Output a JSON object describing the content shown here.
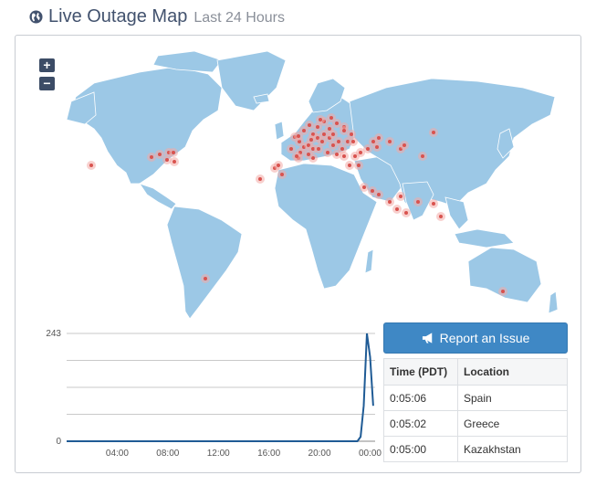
{
  "header": {
    "title": "Live Outage Map",
    "subtitle": "Last 24 Hours"
  },
  "map": {
    "zoom_in": "+",
    "zoom_out": "−",
    "land_color": "#9cc8e6",
    "marker_color": "#d9534f"
  },
  "report_button": {
    "label": "Report an Issue",
    "color": "#3f88c5"
  },
  "table": {
    "headers": [
      "Time (PDT)",
      "Location"
    ],
    "rows": [
      [
        "0:05:06",
        "Spain"
      ],
      [
        "0:05:02",
        "Greece"
      ],
      [
        "0:05:00",
        "Kazakhstan"
      ]
    ]
  },
  "chart_data": {
    "type": "line",
    "y_ticks": [
      "243",
      "0"
    ],
    "ylim": [
      0,
      243
    ],
    "x_ticks": [
      "04:00",
      "08:00",
      "12:00",
      "16:00",
      "20:00",
      "00:00"
    ],
    "series": [
      {
        "x": [
          0,
          1,
          2,
          3,
          4,
          5,
          6,
          7,
          8,
          9,
          10,
          11,
          12,
          13,
          14,
          15,
          16,
          17,
          18,
          19,
          20,
          21,
          22,
          23,
          23.25,
          23.5,
          23.75,
          24,
          24.25
        ],
        "values": [
          0,
          0,
          0,
          0,
          0,
          0,
          0,
          0,
          0,
          0,
          0,
          0,
          0,
          0,
          0,
          0,
          0,
          0,
          0,
          0,
          0,
          0,
          0,
          0,
          10,
          80,
          243,
          190,
          80
        ],
        "color": "#1f5b95"
      }
    ]
  }
}
